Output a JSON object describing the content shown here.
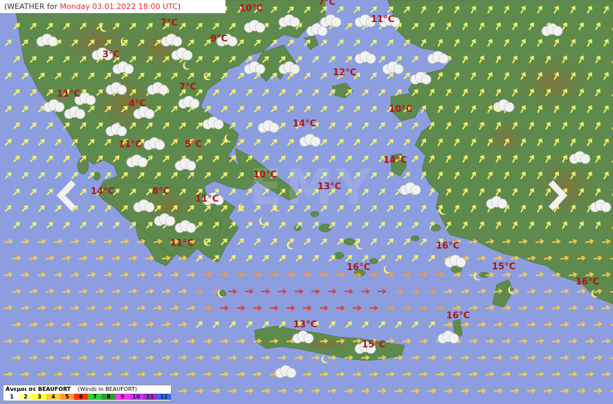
{
  "header": {
    "prefix": "(WEATHER for ",
    "date": "Monday 03.01.2022 18:00 UTC",
    "suffix": ")"
  },
  "temperatures": [
    {
      "label": "10°C"
    },
    {
      "label": "7°C"
    },
    {
      "label": "11°C"
    },
    {
      "label": "7°C"
    },
    {
      "label": "9°C"
    },
    {
      "label": "3°C"
    },
    {
      "label": "12°C"
    },
    {
      "label": "7°C"
    },
    {
      "label": "11°C"
    },
    {
      "label": "4°C"
    },
    {
      "label": "10°C"
    },
    {
      "label": "14°C"
    },
    {
      "label": "11°C"
    },
    {
      "label": "5°C"
    },
    {
      "label": "14°C"
    },
    {
      "label": "10°C"
    },
    {
      "label": "13°C"
    },
    {
      "label": "14°C"
    },
    {
      "label": "8°C"
    },
    {
      "label": "11°C"
    },
    {
      "label": "11°C"
    },
    {
      "label": "16°C"
    },
    {
      "label": "16°C"
    },
    {
      "label": "15°C"
    },
    {
      "label": "16°C"
    },
    {
      "label": "16°C"
    },
    {
      "label": "13°C"
    },
    {
      "label": "15°C"
    }
  ],
  "legend": {
    "title_local": "Ανεμοι σε BEAUFORT",
    "title_en": "(Winds in BEAUFORT)",
    "scale": [
      {
        "label": "1",
        "color": "#ffffff"
      },
      {
        "label": "2",
        "color": "#ffff99"
      },
      {
        "label": "3",
        "color": "#ffff33"
      },
      {
        "label": "4",
        "color": "#ffcc33"
      },
      {
        "label": "5",
        "color": "#ff9933"
      },
      {
        "label": "6",
        "color": "#ff3300"
      },
      {
        "label": "7",
        "color": "#33cc33"
      },
      {
        "label": "8",
        "color": "#339933"
      },
      {
        "label": "9",
        "color": "#ff33ff"
      },
      {
        "label": "10",
        "color": "#cc33ff"
      },
      {
        "label": "11",
        "color": "#9933cc"
      },
      {
        "label": "12",
        "color": "#3366ff"
      }
    ]
  },
  "colors": {
    "sea": "#8c9ee0",
    "land": "#5e8a4e",
    "mountain": "#7a6a3a",
    "temperature_text": "#b01515",
    "date_text": "#e8282a"
  },
  "navigation": {
    "prev_icon": "chevron-left-icon",
    "next_icon": "chevron-right-icon"
  }
}
